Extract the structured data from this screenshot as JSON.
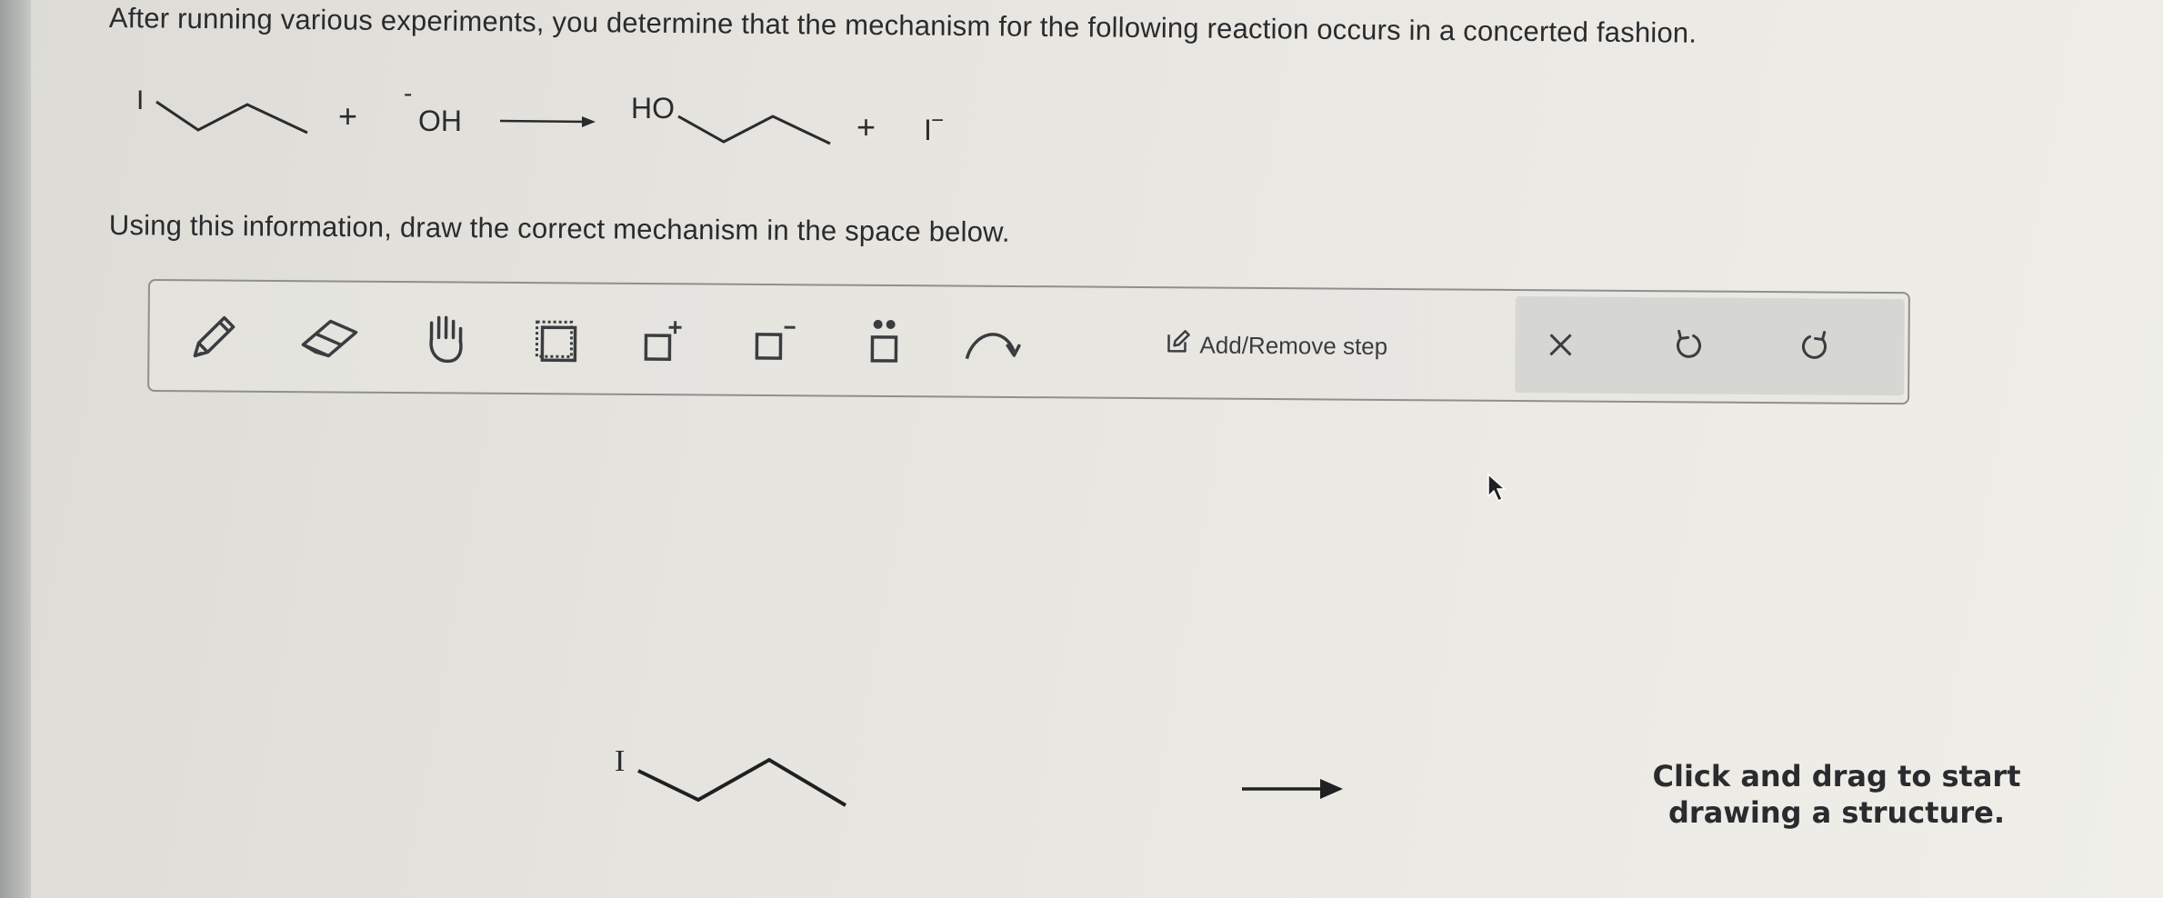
{
  "question": {
    "line1": "After running various experiments, you determine that the mechanism for the following reaction occurs in a concerted fashion.",
    "line2": "Using this information, draw the correct mechanism in the space below."
  },
  "reaction": {
    "reactant_atom": "I",
    "plus1": "+",
    "nucleophile_charge": "-",
    "nucleophile": "OH",
    "product_group": "HO",
    "plus2": "+",
    "leaving_group": "I",
    "leaving_charge": "−"
  },
  "toolbar": {
    "tools": [
      "pencil-icon",
      "eraser-icon",
      "hand-icon",
      "select-box-icon",
      "add-positive-charge-icon",
      "add-negative-charge-icon",
      "add-lone-pair-icon",
      "curved-arrow-icon"
    ],
    "add_remove_step": "Add/Remove step",
    "right_buttons": [
      "clear-icon",
      "undo-icon",
      "redo-icon"
    ]
  },
  "canvas": {
    "start_atom": "I",
    "hint": "Click and drag to start drawing a structure."
  }
}
